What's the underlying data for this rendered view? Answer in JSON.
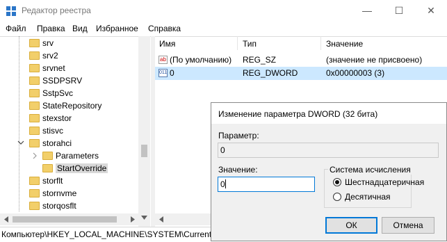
{
  "window": {
    "title": "Редактор реестра",
    "minimize_glyph": "—",
    "maximize_glyph": "☐",
    "close_glyph": "✕"
  },
  "menu": [
    "Файл",
    "Правка",
    "Вид",
    "Избранное",
    "Справка"
  ],
  "tree": {
    "items": [
      {
        "label": "srv",
        "level": 0
      },
      {
        "label": "srv2",
        "level": 0
      },
      {
        "label": "srvnet",
        "level": 0
      },
      {
        "label": "SSDPSRV",
        "level": 0
      },
      {
        "label": "SstpSvc",
        "level": 0
      },
      {
        "label": "StateRepository",
        "level": 0
      },
      {
        "label": "stexstor",
        "level": 0
      },
      {
        "label": "stisvc",
        "level": 0
      },
      {
        "label": "storahci",
        "level": 0,
        "expanded": true
      },
      {
        "label": "Parameters",
        "level": 1
      },
      {
        "label": "StartOverride",
        "level": 1,
        "selected": true
      },
      {
        "label": "storflt",
        "level": 0
      },
      {
        "label": "stornvme",
        "level": 0
      },
      {
        "label": "storqosflt",
        "level": 0
      }
    ]
  },
  "list": {
    "columns": [
      "Имя",
      "Тип",
      "Значение"
    ],
    "rows": [
      {
        "icon": "string-value-icon",
        "name": "(По умолчанию)",
        "type": "REG_SZ",
        "value": "(значение не присвоено)"
      },
      {
        "icon": "binary-value-icon",
        "name": "0",
        "type": "REG_DWORD",
        "value": "0x00000003 (3)",
        "selected": true
      }
    ]
  },
  "status": {
    "path": "Компьютер\\HKEY_LOCAL_MACHINE\\SYSTEM\\CurrentC"
  },
  "dialog": {
    "title": "Изменение параметра DWORD (32 бита)",
    "param_label": "Параметр:",
    "param_value": "0",
    "value_label": "Значение:",
    "value_value": "0",
    "base_label": "Система исчисления",
    "radio_hex": "Шестнадцатеричная",
    "radio_dec": "Десятичная",
    "selected_base": "hex",
    "ok_label": "ОК",
    "cancel_label": "Отмена"
  },
  "colors": {
    "accent": "#0078d7",
    "selection": "#cce8ff",
    "folder": "#f2cf6a"
  }
}
